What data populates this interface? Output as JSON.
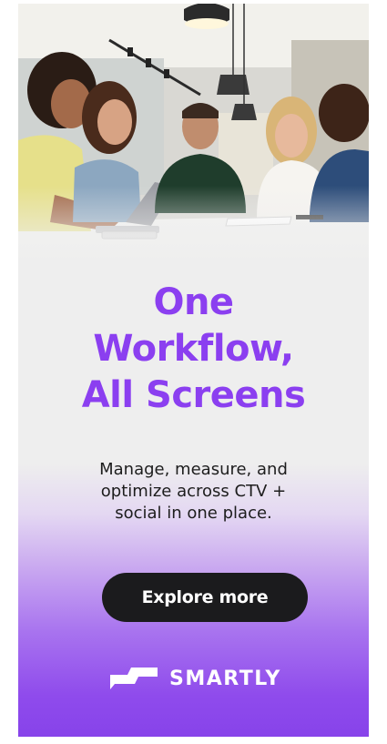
{
  "ad": {
    "headline_lines": [
      "One",
      "Workflow,",
      "All Screens"
    ],
    "subtext_lines": [
      "Manage, measure, and",
      "optimize across CTV +",
      "social in one place."
    ],
    "cta_label": "Explore more",
    "brand_name": "SMARTLY",
    "logo_icon": "smartly-logo-icon"
  },
  "photo": {
    "description_icon": "team-meeting-photo"
  },
  "colors": {
    "headline": "#8b3ff0",
    "cta_background": "#1b1b1d",
    "cta_text": "#ffffff",
    "gradient_bottom": "#8743ea",
    "panel_background": "#eeeeee"
  }
}
